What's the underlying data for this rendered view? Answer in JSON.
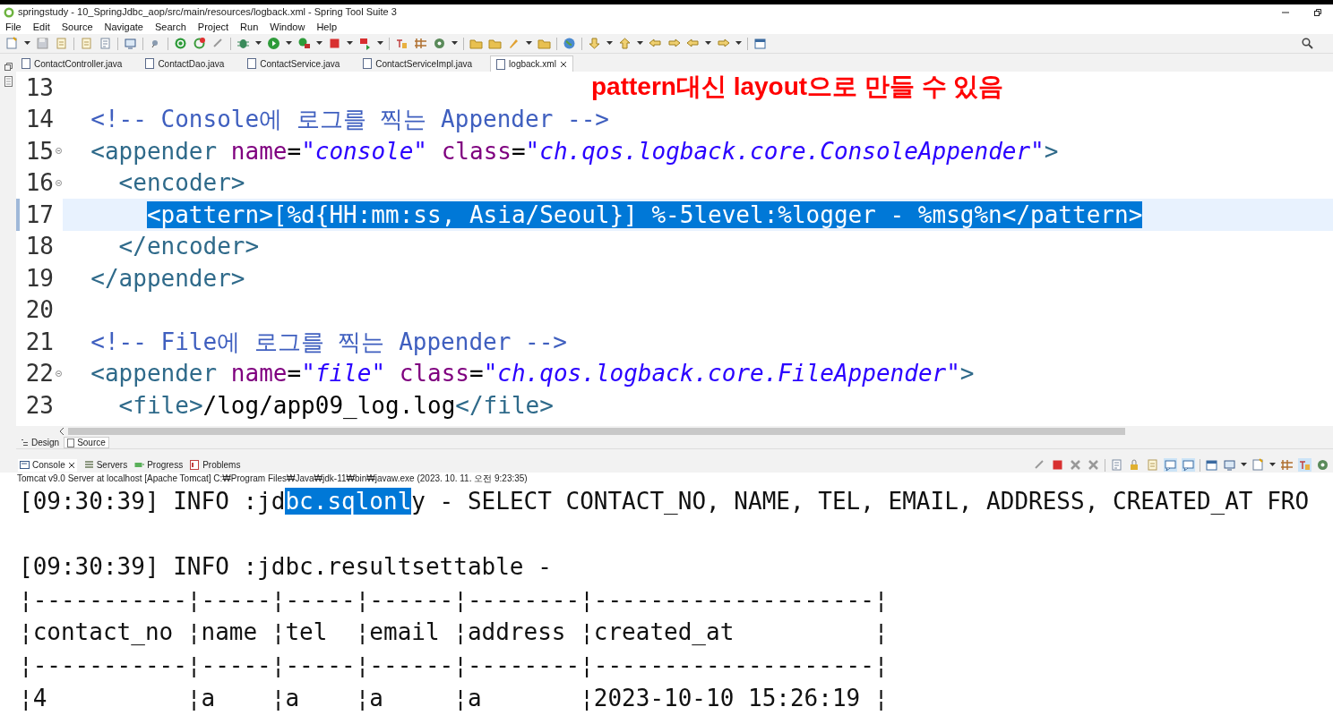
{
  "window": {
    "title": "springstudy - 10_SpringJdbc_aop/src/main/resources/logback.xml - Spring Tool Suite 3"
  },
  "menu": [
    "File",
    "Edit",
    "Source",
    "Navigate",
    "Search",
    "Project",
    "Run",
    "Window",
    "Help"
  ],
  "editor_tabs": [
    {
      "label": "ContactController.java",
      "selected": false
    },
    {
      "label": "ContactDao.java",
      "selected": false
    },
    {
      "label": "ContactService.java",
      "selected": false
    },
    {
      "label": "ContactServiceImpl.java",
      "selected": false
    },
    {
      "label": "logback.xml",
      "selected": true
    }
  ],
  "annotation": "pattern대신 layout으로 만들 수 있음",
  "code_lines": [
    {
      "number": "13",
      "foldable": false,
      "current": false
    },
    {
      "number": "14",
      "foldable": false,
      "current": false,
      "tokens": [
        {
          "kind": "comment",
          "text": "<!-- Console에 로그를 찍는 Appender -->"
        }
      ]
    },
    {
      "number": "15",
      "foldable": true,
      "current": false,
      "tokens": [
        {
          "kind": "tag",
          "text": "<appender "
        },
        {
          "kind": "attr",
          "text": "name"
        },
        {
          "kind": "text",
          "text": "="
        },
        {
          "kind": "value",
          "text": "\"console\""
        },
        {
          "kind": "attr",
          "text": " class"
        },
        {
          "kind": "text",
          "text": "="
        },
        {
          "kind": "value",
          "text": "\"ch.qos.logback.core.ConsoleAppender\""
        },
        {
          "kind": "tag",
          "text": ">"
        }
      ],
      "children": [
        {
          "number": "16",
          "foldable": true,
          "current": false,
          "tokens": [
            {
              "kind": "tag",
              "text": "<encoder>"
            }
          ],
          "children": [
            {
              "number": "17",
              "foldable": false,
              "current": true,
              "tokens": [
                {
                  "kind": "selected",
                  "text": "<pattern>[%d{HH:mm:ss, Asia/Seoul}] %-5level:%logger - %msg%n</pattern>"
                }
              ]
            }
          ]
        },
        {
          "number": "18",
          "foldable": false,
          "current": false,
          "tokens": [
            {
              "kind": "tag",
              "text": "</encoder>"
            }
          ]
        }
      ]
    },
    {
      "number": "19",
      "foldable": false,
      "current": false,
      "tokens": [
        {
          "kind": "tag",
          "text": "</appender>"
        }
      ]
    },
    {
      "number": "20",
      "foldable": false,
      "current": false
    },
    {
      "number": "21",
      "foldable": false,
      "current": false,
      "tokens": [
        {
          "kind": "comment",
          "text": "<!-- File에 로그를 찍는 Appender -->"
        }
      ]
    },
    {
      "number": "22",
      "foldable": true,
      "current": false,
      "tokens": [
        {
          "kind": "tag",
          "text": "<appender "
        },
        {
          "kind": "attr",
          "text": "name"
        },
        {
          "kind": "text",
          "text": "="
        },
        {
          "kind": "value",
          "text": "\"file\""
        },
        {
          "kind": "attr",
          "text": " class"
        },
        {
          "kind": "text",
          "text": "="
        },
        {
          "kind": "value",
          "text": "\"ch.qos.logback.core.FileAppender\""
        },
        {
          "kind": "tag",
          "text": ">"
        }
      ],
      "children": [
        {
          "number": "23",
          "foldable": false,
          "current": false,
          "tokens": [
            {
              "kind": "tag",
              "text": "<file>"
            },
            {
              "kind": "text",
              "text": "/log/app09_log.log"
            },
            {
              "kind": "tag",
              "text": "</file>"
            }
          ]
        }
      ]
    }
  ],
  "editor_mode_tabs": [
    {
      "label": "Design",
      "selected": false
    },
    {
      "label": "Source",
      "selected": true
    }
  ],
  "panel_tabs": [
    {
      "label": "Console",
      "selected": true
    },
    {
      "label": "Servers",
      "selected": false
    },
    {
      "label": "Progress",
      "selected": false
    },
    {
      "label": "Problems",
      "selected": false
    }
  ],
  "console": {
    "process": "Tomcat v9.0 Server at localhost [Apache Tomcat] C:₩Program Files₩Java₩jdk-11₩bin₩javaw.exe  (2023. 10. 11. 오전 9:23:35)",
    "lines": [
      {
        "segments": [
          {
            "text": "[09:30:39] INFO :jd",
            "selected": false
          },
          {
            "text": "bc.sqlonl",
            "selected": true
          },
          {
            "text": "y - SELECT CONTACT_NO, NAME, TEL, EMAIL, ADDRESS, CREATED_AT FRO",
            "selected": false
          }
        ]
      },
      {
        "blank_before": true,
        "segments": [
          {
            "text": "[09:30:39] INFO :jdbc.resultsettable -",
            "selected": false
          }
        ]
      },
      {
        "segments": [
          {
            "text": "¦-----------¦-----¦-----¦------¦--------¦--------------------¦",
            "selected": false
          }
        ]
      },
      {
        "segments": [
          {
            "text": "¦contact_no ¦name ¦tel  ¦email ¦address ¦created_at          ¦",
            "selected": false
          }
        ]
      },
      {
        "segments": [
          {
            "text": "¦-----------¦-----¦-----¦------¦--------¦--------------------¦",
            "selected": false
          }
        ]
      },
      {
        "segments": [
          {
            "text": "¦4          ¦a    ¦a    ¦a     ¦a       ¦2023-10-10 15:26:19 ¦",
            "selected": false
          }
        ]
      }
    ]
  }
}
